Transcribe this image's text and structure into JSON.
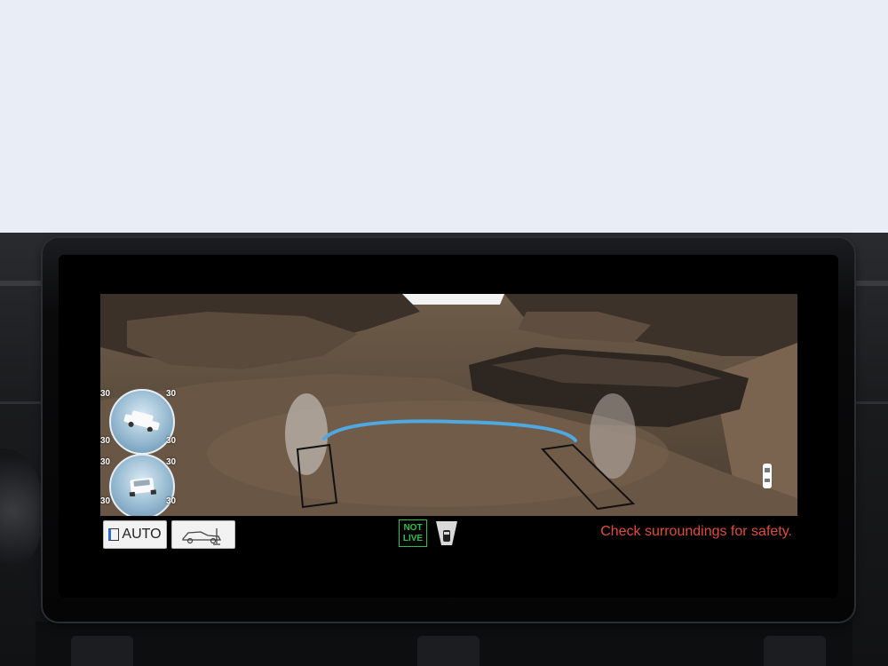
{
  "incline_meters": {
    "pitch": {
      "labels": [
        "30",
        "30",
        "30",
        "30"
      ]
    },
    "roll": {
      "labels": [
        "30",
        "30",
        "30",
        "30"
      ]
    }
  },
  "status_bar": {
    "auto_button_label": "AUTO",
    "not_live_line1": "NOT",
    "not_live_line2": "LIVE",
    "warning_text": "Check surroundings for safety."
  },
  "colors": {
    "guide_line": "#4fa8e0",
    "warning": "#e24b3a",
    "not_live": "#27c44a"
  },
  "icons": [
    "auto-view-icon",
    "vehicle-mode-icon",
    "camera-view-icon",
    "vehicle-top-icon"
  ]
}
